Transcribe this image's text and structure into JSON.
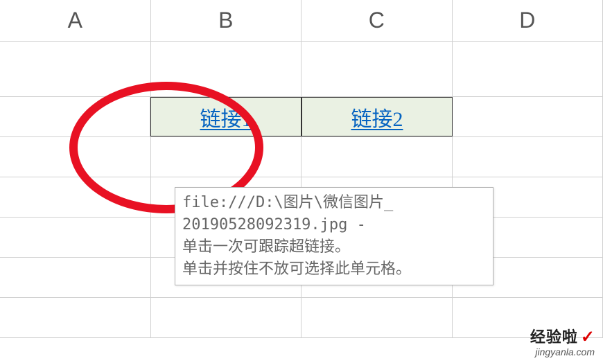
{
  "headers": {
    "a": "A",
    "b": "B",
    "c": "C",
    "d": "D"
  },
  "cells": {
    "link1": "链接1",
    "link2": "链接2"
  },
  "tooltip": {
    "line1": "file:///D:\\图片\\微信图片_",
    "line2": "20190528092319.jpg -",
    "line3": "单击一次可跟踪超链接。",
    "line4": "单击并按住不放可选择此单元格。"
  },
  "watermark": {
    "main": "经验啦",
    "check": "✓",
    "sub": "jingyanla.com"
  }
}
